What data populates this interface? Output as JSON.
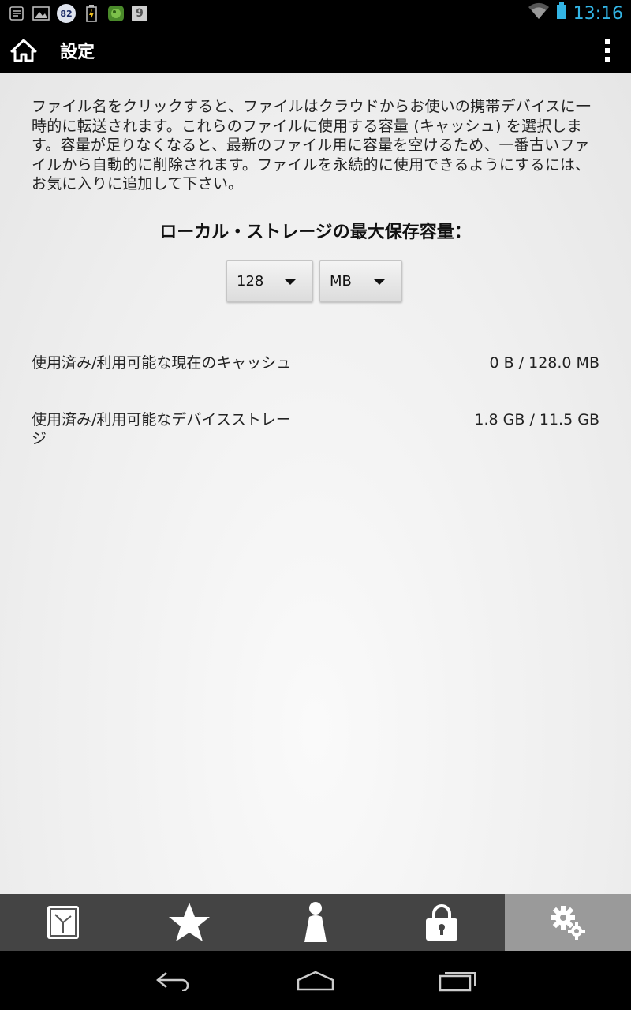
{
  "status_bar": {
    "time": "13:16",
    "badge_number": "82",
    "calendar_day": "9",
    "icons": [
      "notes-icon",
      "image-icon",
      "badge-icon",
      "battery-charging-icon",
      "app-icon",
      "calendar-icon",
      "wifi-icon",
      "battery-icon"
    ]
  },
  "action_bar": {
    "title": "設定",
    "home_icon": "home-icon",
    "overflow_icon": "overflow-menu-icon"
  },
  "content": {
    "description": "ファイル名をクリックすると、ファイルはクラウドからお使いの携帯デバイスに一時的に転送されます。これらのファイルに使用する容量 (キャッシュ) を選択します。容量が足りなくなると、最新のファイル用に容量を空けるため、一番古いファイルから自動的に削除されます。ファイルを永続的に使用できるようにするには、お気に入りに追加して下さい。",
    "storage_title": "ローカル・ストレージの最大保存容量：",
    "size_select": {
      "value": "128"
    },
    "unit_select": {
      "value": "MB"
    },
    "rows": [
      {
        "label": "使用済み/利用可能な現在のキャッシュ",
        "value": "0 B / 128.0 MB"
      },
      {
        "label": "使用済み/利用可能なデバイスストレージ",
        "value": "1.8 GB / 11.5 GB"
      }
    ]
  },
  "tabs": [
    {
      "icon": "clock-icon",
      "active": false
    },
    {
      "icon": "star-icon",
      "active": false
    },
    {
      "icon": "person-icon",
      "active": false
    },
    {
      "icon": "lock-icon",
      "active": false
    },
    {
      "icon": "gears-icon",
      "active": true
    }
  ],
  "nav": [
    "back-icon",
    "home-nav-icon",
    "recents-icon"
  ],
  "colors": {
    "status_accent": "#33b5e5",
    "tab_bar": "#444444",
    "tab_active": "#9a9a9a",
    "content_bg": "#efefef"
  }
}
